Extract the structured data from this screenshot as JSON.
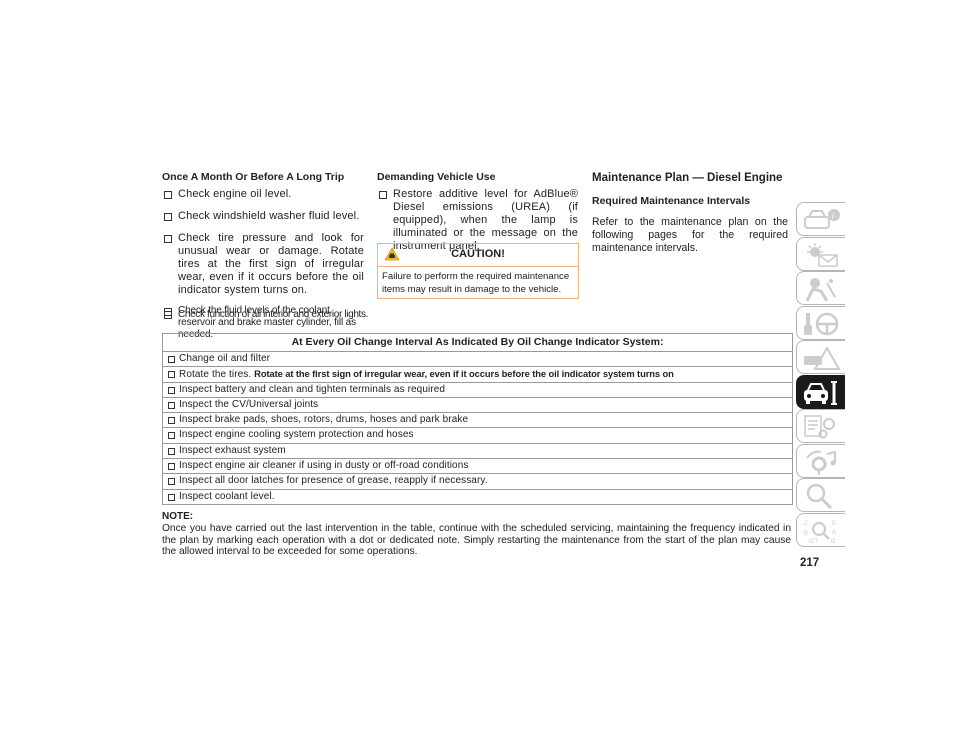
{
  "col1": {
    "heading": "Once A Month Or Before A Long Trip",
    "items": [
      "Check engine oil level.",
      "Check windshield washer fluid level.",
      "Check tire pressure and look for unusual wear or damage. Rotate tires at the first sign of irregular wear, even if it occurs before the oil indicator system turns on.",
      "Check the fluid levels of the coolant reservoir and brake master cylinder, fill as needed.",
      "Check function of all interior and exterior lights."
    ]
  },
  "col2": {
    "heading": "Demanding Vehicle Use",
    "items": [
      "Restore additive level for AdBlue® Diesel emissions (UREA) (if equipped), when the lamp is illuminated or the message on the instrument panel."
    ],
    "caution": {
      "icon": "caution-warning-icon",
      "title": "CAUTION!",
      "text": "Failure to perform the required maintenance items may result in damage to the vehicle."
    }
  },
  "col3": {
    "heading": "Maintenance Plan — Diesel Engine",
    "subheading": "Required Maintenance Intervals",
    "paragraph": "Refer to the maintenance plan on the following pages for the required maintenance intervals."
  },
  "table": {
    "header": "At Every Oil Change Interval As Indicated By Oil Change Indicator System:",
    "rows": [
      {
        "text": "Change oil and filter",
        "bold": ""
      },
      {
        "text": "Rotate the tires. ",
        "bold": "Rotate at the first sign of irregular wear, even if it occurs before the oil indicator system turns on"
      },
      {
        "text": "Inspect battery and clean and tighten terminals as required",
        "bold": ""
      },
      {
        "text": "Inspect the CV/Universal joints",
        "bold": ""
      },
      {
        "text": "Inspect brake pads, shoes, rotors, drums, hoses and park brake",
        "bold": ""
      },
      {
        "text": "Inspect engine cooling system protection and hoses",
        "bold": ""
      },
      {
        "text": "Inspect exhaust system",
        "bold": ""
      },
      {
        "text": "Inspect engine air cleaner if using in dusty or off-road conditions",
        "bold": ""
      },
      {
        "text": "Inspect all door latches for presence of grease, reapply if necessary.",
        "bold": ""
      },
      {
        "text": "Inspect coolant level.",
        "bold": ""
      }
    ]
  },
  "note": {
    "label": "NOTE:",
    "text": "Once you have carried out the last intervention in the table, continue with the scheduled servicing, maintaining the frequency indicated in the plan by marking each operation with a dot or dedicated note. Simply restarting the maintenance from the start of the plan may cause the allowed interval to be exceeded for some operations."
  },
  "side_tabs": [
    {
      "icon": "car-info-icon",
      "active": false
    },
    {
      "icon": "lights-message-icon",
      "active": false
    },
    {
      "icon": "airbag-seat-icon",
      "active": false
    },
    {
      "icon": "key-steering-wheel-icon",
      "active": false
    },
    {
      "icon": "car-hazard-icon",
      "active": false
    },
    {
      "icon": "car-wrench-icon",
      "active": true
    },
    {
      "icon": "specs-gear-icon",
      "active": false
    },
    {
      "icon": "multimedia-icon",
      "active": false
    },
    {
      "icon": "search-index-icon",
      "active": false
    },
    {
      "icon": "language-index-icon",
      "active": false
    }
  ],
  "page_number": "217",
  "colors": {
    "caution_border": "#f2b27a",
    "caution_icon": "#f5b323",
    "active_tab": "#1a1a1a",
    "tab_outline": "#b5b5b5"
  }
}
